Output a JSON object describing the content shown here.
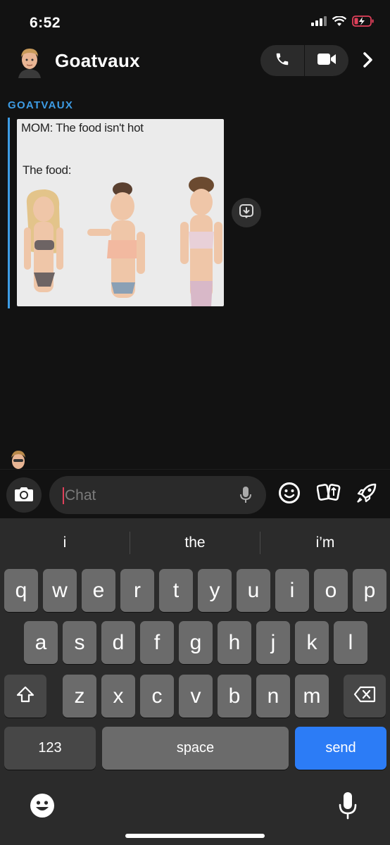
{
  "status": {
    "time": "6:52"
  },
  "header": {
    "contact_name": "Goatvaux"
  },
  "messages": [
    {
      "sender": "GOATVAUX",
      "meme_text_top": "MOM: The food isn't hot",
      "meme_text_bottom": "The food:"
    }
  ],
  "compose": {
    "placeholder": "Chat"
  },
  "keyboard": {
    "suggestions": [
      "i",
      "the",
      "i’m"
    ],
    "row1": [
      "q",
      "w",
      "e",
      "r",
      "t",
      "y",
      "u",
      "i",
      "o",
      "p"
    ],
    "row2": [
      "a",
      "s",
      "d",
      "f",
      "g",
      "h",
      "j",
      "k",
      "l"
    ],
    "row3": [
      "z",
      "x",
      "c",
      "v",
      "b",
      "n",
      "m"
    ],
    "numbers_label": "123",
    "space_label": "space",
    "send_label": "send"
  },
  "colors": {
    "accent": "#3d9ce5",
    "send": "#2c7cf6",
    "background": "#121212",
    "caret": "#e0405a"
  },
  "icons": [
    "signal-icon",
    "wifi-icon",
    "battery-charging-icon",
    "phone-icon",
    "video-icon",
    "chevron-right-icon",
    "download-icon",
    "camera-icon",
    "microphone-icon",
    "smiley-icon",
    "cards-icon",
    "rocket-icon",
    "shift-icon",
    "backspace-icon",
    "emoji-icon",
    "dictation-icon"
  ]
}
